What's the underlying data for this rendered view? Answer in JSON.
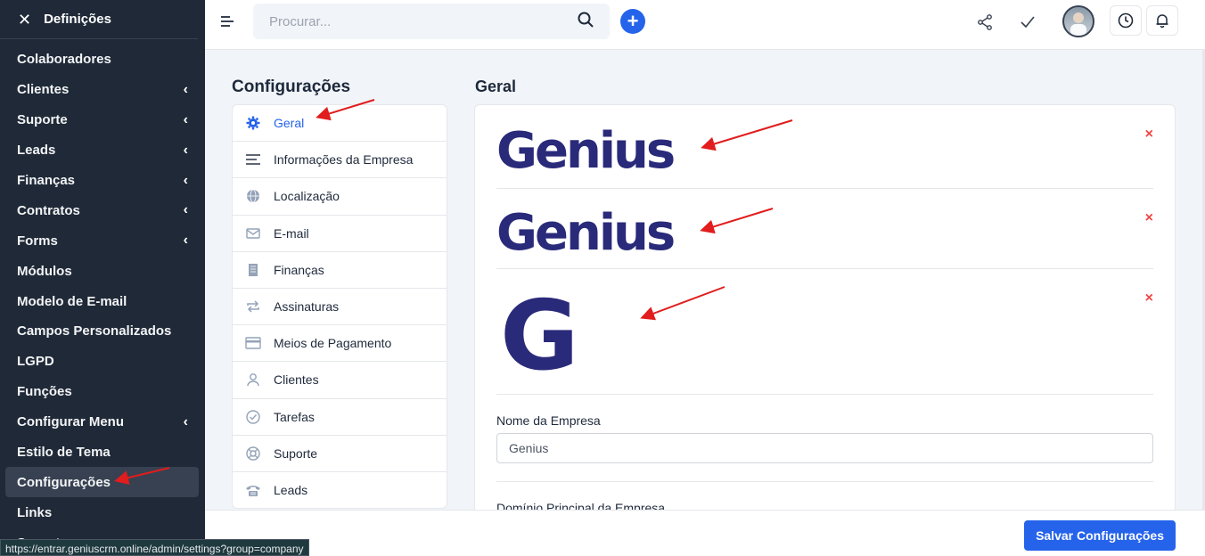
{
  "sidebar": {
    "close_glyph": "✕",
    "title": "Definições",
    "items": [
      {
        "label": "Colaboradores",
        "chevron": ""
      },
      {
        "label": "Clientes",
        "chevron": "‹"
      },
      {
        "label": "Suporte",
        "chevron": "‹"
      },
      {
        "label": "Leads",
        "chevron": "‹"
      },
      {
        "label": "Finanças",
        "chevron": "‹"
      },
      {
        "label": "Contratos",
        "chevron": "‹"
      },
      {
        "label": "Forms",
        "chevron": "‹"
      },
      {
        "label": "Módulos",
        "chevron": ""
      },
      {
        "label": "Modelo de E-mail",
        "chevron": ""
      },
      {
        "label": "Campos Personalizados",
        "chevron": ""
      },
      {
        "label": "LGPD",
        "chevron": ""
      },
      {
        "label": "Funções",
        "chevron": ""
      },
      {
        "label": "Configurar Menu",
        "chevron": "‹"
      },
      {
        "label": "Estilo de Tema",
        "chevron": ""
      },
      {
        "label": "Configurações",
        "chevron": "",
        "active": true
      },
      {
        "label": "Links",
        "chevron": ""
      },
      {
        "label": "Suporte",
        "chevron": ""
      }
    ]
  },
  "topbar": {
    "search_placeholder": "Procurar...",
    "add_glyph": "+"
  },
  "settings_nav": {
    "title": "Configurações",
    "items": [
      {
        "label": "Geral",
        "icon": "gear-icon",
        "active": true
      },
      {
        "label": "Informações da Empresa",
        "icon": "lines-icon"
      },
      {
        "label": "Localização",
        "icon": "globe-icon"
      },
      {
        "label": "E-mail",
        "icon": "envelope-icon"
      },
      {
        "label": "Finanças",
        "icon": "receipt-icon"
      },
      {
        "label": "Assinaturas",
        "icon": "repeat-icon"
      },
      {
        "label": "Meios de Pagamento",
        "icon": "credit-card-icon"
      },
      {
        "label": "Clientes",
        "icon": "user-icon"
      },
      {
        "label": "Tarefas",
        "icon": "check-circle-icon"
      },
      {
        "label": "Suporte",
        "icon": "lifebuoy-icon"
      },
      {
        "label": "Leads",
        "icon": "phone-icon"
      }
    ]
  },
  "main": {
    "title": "Geral",
    "logos": [
      {
        "text": "Genius",
        "remove": "×"
      },
      {
        "text": "Genius",
        "remove": "×"
      },
      {
        "text": "G",
        "remove": "×"
      }
    ],
    "company_name_label": "Nome da Empresa",
    "company_name_value": "Genius",
    "domain_label": "Domínio Principal da Empresa"
  },
  "footer": {
    "save_label": "Salvar Configurações"
  },
  "status_url": "https://entrar.geniuscrm.online/admin/settings?group=company",
  "colors": {
    "accent": "#2563eb",
    "sidebar_bg": "#1f2937",
    "logo": "#2a2a7a",
    "annotation_arrow": "#e11d1d"
  }
}
